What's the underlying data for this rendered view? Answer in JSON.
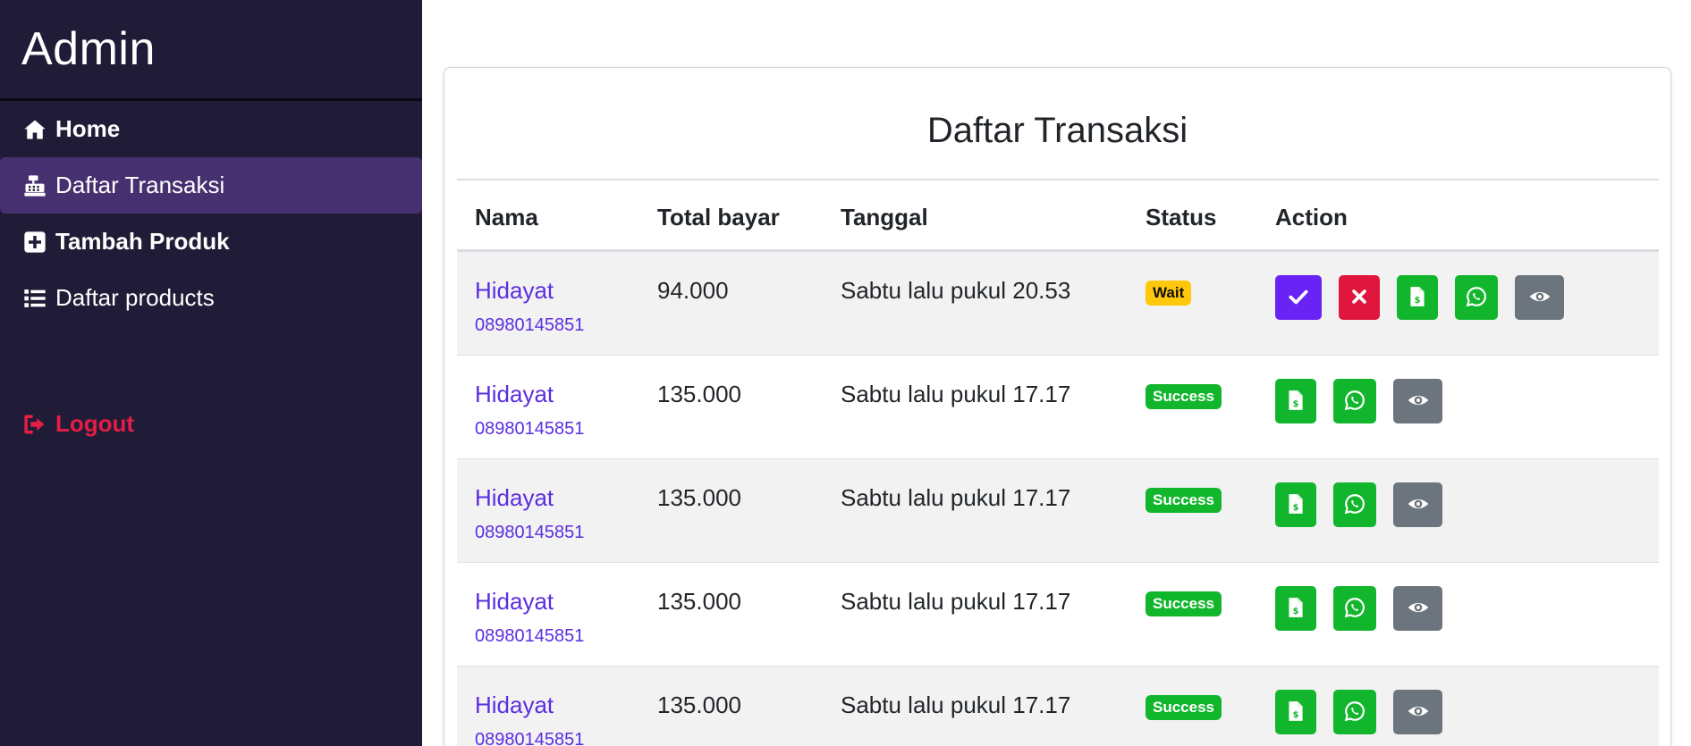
{
  "sidebar": {
    "brand": "Admin",
    "items": [
      {
        "label": "Home",
        "icon": "home-icon"
      },
      {
        "label": "Daftar Transaksi",
        "icon": "cash-register-icon"
      },
      {
        "label": "Tambah Produk",
        "icon": "plus-square-icon"
      },
      {
        "label": "Daftar products",
        "icon": "list-icon"
      }
    ],
    "logout": {
      "label": "Logout",
      "icon": "sign-out-icon"
    }
  },
  "main": {
    "title": "Daftar Transaksi",
    "columns": [
      "Nama",
      "Total bayar",
      "Tanggal",
      "Status",
      "Action"
    ],
    "rows": [
      {
        "name": "Hidayat",
        "phone": "08980145851",
        "total": "94.000",
        "date": "Sabtu lalu pukul 20.53",
        "status": "Wait",
        "actions": [
          "check-icon",
          "times-icon",
          "invoice-icon",
          "whatsapp-icon",
          "eye-icon"
        ]
      },
      {
        "name": "Hidayat",
        "phone": "08980145851",
        "total": "135.000",
        "date": "Sabtu lalu pukul 17.17",
        "status": "Success",
        "actions": [
          "invoice-icon",
          "whatsapp-icon",
          "eye-icon"
        ]
      },
      {
        "name": "Hidayat",
        "phone": "08980145851",
        "total": "135.000",
        "date": "Sabtu lalu pukul 17.17",
        "status": "Success",
        "actions": [
          "invoice-icon",
          "whatsapp-icon",
          "eye-icon"
        ]
      },
      {
        "name": "Hidayat",
        "phone": "08980145851",
        "total": "135.000",
        "date": "Sabtu lalu pukul 17.17",
        "status": "Success",
        "actions": [
          "invoice-icon",
          "whatsapp-icon",
          "eye-icon"
        ]
      },
      {
        "name": "Hidayat",
        "phone": "08980145851",
        "total": "135.000",
        "date": "Sabtu lalu pukul 17.17",
        "status": "Success",
        "actions": [
          "invoice-icon",
          "whatsapp-icon",
          "eye-icon"
        ]
      }
    ]
  },
  "colors": {
    "sidebar_bg": "#201c37",
    "active_bg": "#47306f",
    "logout": "#e31d45",
    "link": "#5b2ee0",
    "wait": "#ffc80a",
    "success": "#12b62c",
    "approve": "#6a23f5",
    "reject": "#e0163f",
    "view": "#6c757d"
  }
}
